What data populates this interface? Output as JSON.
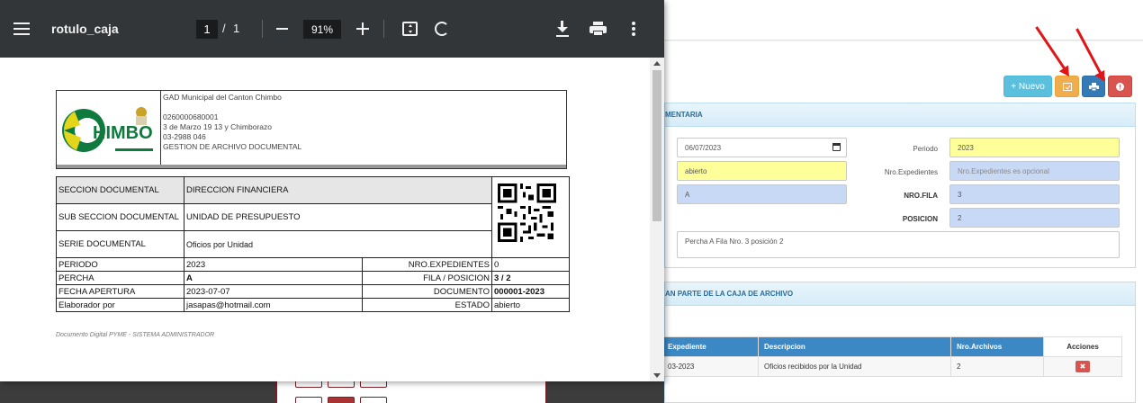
{
  "viewer": {
    "title": "rotulo_caja",
    "page_current": "1",
    "page_sep": "/",
    "page_total": "1",
    "zoom": "91%"
  },
  "document": {
    "org_lines": [
      "GAD Municipal del Canton Chimbo",
      "",
      "0260000680001",
      "3 de Marzo 19 13 y Chimborazo",
      "03-2988 046",
      "GESTION DE ARCHIVO DOCUMENTAL"
    ],
    "logo_text": "HIMBO",
    "rows_top": [
      {
        "label": "SECCION DOCUMENTAL",
        "value": "DIRECCION FINANCIERA"
      },
      {
        "label": "SUB SECCION DOCUMENTAL",
        "value": "UNIDAD DE PRESUPUESTO"
      },
      {
        "label": "SERIE DOCUMENTAL",
        "value": "Oficios por Unidad"
      }
    ],
    "rows_bottom": [
      {
        "l1": "PERIODO",
        "v1": "2023",
        "l2": "NRO.EXPEDIENTES",
        "v2": "0"
      },
      {
        "l1": "PERCHA",
        "v1": "A",
        "l2": "FILA / POSICION",
        "v2": "3 / 2"
      },
      {
        "l1": "FECHA APERTURA",
        "v1": "2023-07-07",
        "l2": "DOCUMENTO",
        "v2": "000001-2023"
      },
      {
        "l1": "Elaborador por",
        "v1": "jasapas@hotmail.com",
        "l2": "ESTADO",
        "v2": "abierto"
      }
    ],
    "footer": "Documento Digital PYME - SISTEMA ADMINISTRADOR"
  },
  "toolbar": {
    "new_label": "+ Nuevo"
  },
  "form_panel": {
    "title": "MENTARIA",
    "date_value": "06/07/2023",
    "estado_value": "abierto",
    "percha_value": "A",
    "periodo_label": "Periodo",
    "periodo_value": "2023",
    "nroexp_label": "Nro.Expedientes",
    "nroexp_placeholder": "Nro.Expedientes es opcional",
    "fila_label": "NRO.FILA",
    "fila_value": "3",
    "posicion_label": "POSICION",
    "posicion_value": "2",
    "desc_value": "Percha A Fila Nro. 3 posición 2"
  },
  "list_panel": {
    "title": "AN PARTE DE LA CAJA DE ARCHIVO",
    "columns": [
      "Expediente",
      "Descripcion",
      "Nro.Archivos",
      "Acciones"
    ],
    "rows": [
      {
        "expediente": "03-2023",
        "descripcion": "Oficios recibidos por la Unidad",
        "archivos": "2"
      }
    ]
  },
  "colors": {
    "accent": "#3b88c4",
    "viewer_bar": "#323639",
    "highlight_yellow": "#ffff99",
    "highlight_blue": "#c7d9f5"
  }
}
